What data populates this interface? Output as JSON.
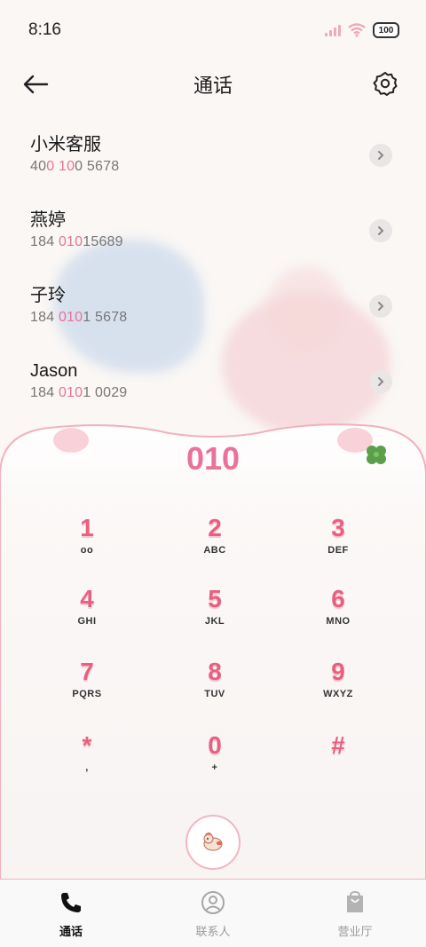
{
  "status": {
    "time": "8:16",
    "battery": "100"
  },
  "header": {
    "title": "通话"
  },
  "contacts": [
    {
      "name": "小米客服",
      "num_a": "40",
      "num_hl1": "0",
      "num_b": " ",
      "num_hl2": "10",
      "num_c": "0 5678"
    },
    {
      "name": "燕婷",
      "num_a": "184 ",
      "num_hl1": "010",
      "num_b": "",
      "num_hl2": "",
      "num_c": "15689"
    },
    {
      "name": "子玲",
      "num_a": "184 ",
      "num_hl1": "010",
      "num_b": "",
      "num_hl2": "",
      "num_c": "1 5678"
    },
    {
      "name": "Jason",
      "num_a": "184 ",
      "num_hl1": "010",
      "num_b": "",
      "num_hl2": "",
      "num_c": "1 0029"
    }
  ],
  "dialer": {
    "input": "010"
  },
  "keypad": [
    {
      "digit": "1",
      "letters": "ᴏᴏ"
    },
    {
      "digit": "2",
      "letters": "ABC"
    },
    {
      "digit": "3",
      "letters": "DEF"
    },
    {
      "digit": "4",
      "letters": "GHI"
    },
    {
      "digit": "5",
      "letters": "JKL"
    },
    {
      "digit": "6",
      "letters": "MNO"
    },
    {
      "digit": "7",
      "letters": "PQRS"
    },
    {
      "digit": "8",
      "letters": "TUV"
    },
    {
      "digit": "9",
      "letters": "WXYZ"
    },
    {
      "digit": "*",
      "letters": ","
    },
    {
      "digit": "0",
      "letters": "+"
    },
    {
      "digit": "#",
      "letters": ""
    }
  ],
  "nav": [
    {
      "label": "通话",
      "icon": "phone-icon",
      "active": true
    },
    {
      "label": "联系人",
      "icon": "person-icon",
      "active": false
    },
    {
      "label": "营业厅",
      "icon": "bag-icon",
      "active": false
    }
  ],
  "colors": {
    "accent": "#e8729a",
    "key_digit": "#e8607f"
  }
}
